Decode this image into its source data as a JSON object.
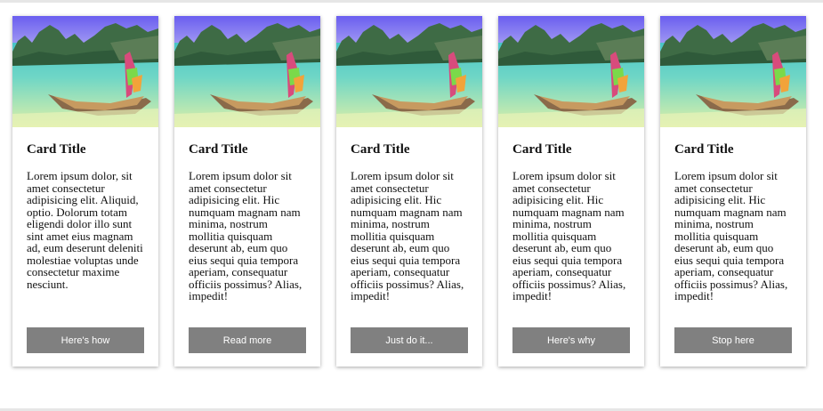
{
  "cards": [
    {
      "title": "Card Title",
      "text": "Lorem ipsum dolor, sit amet consectetur adipisicing elit. Aliquid, optio. Dolorum totam eligendi dolor illo sunt sint amet eius magnam ad, eum deserunt deleniti molestiae voluptas unde consectetur maxime nesciunt.",
      "button": "Here's how"
    },
    {
      "title": "Card Title",
      "text": "Lorem ipsum dolor sit amet consectetur adipisicing elit. Hic numquam magnam nam minima, nostrum mollitia quisquam deserunt ab, eum quo eius sequi quia tempora aperiam, consequatur officiis possimus? Alias, impedit!",
      "button": "Read more"
    },
    {
      "title": "Card Title",
      "text": "Lorem ipsum dolor sit amet consectetur adipisicing elit. Hic numquam magnam nam minima, nostrum mollitia quisquam deserunt ab, eum quo eius sequi quia tempora aperiam, consequatur officiis possimus? Alias, impedit!",
      "button": "Just do it..."
    },
    {
      "title": "Card Title",
      "text": "Lorem ipsum dolor sit amet consectetur adipisicing elit. Hic numquam magnam nam minima, nostrum mollitia quisquam deserunt ab, eum quo eius sequi quia tempora aperiam, consequatur officiis possimus? Alias, impedit!",
      "button": "Here's why"
    },
    {
      "title": "Card Title",
      "text": "Lorem ipsum dolor sit amet consectetur adipisicing elit. Hic numquam magnam nam minima, nostrum mollitia quisquam deserunt ab, eum quo eius sequi quia tempora aperiam, consequatur officiis possimus? Alias, impedit!",
      "button": "Stop here"
    }
  ],
  "colors": {
    "button_bg": "#808080",
    "button_text": "#ffffff",
    "card_bg": "#ffffff"
  }
}
